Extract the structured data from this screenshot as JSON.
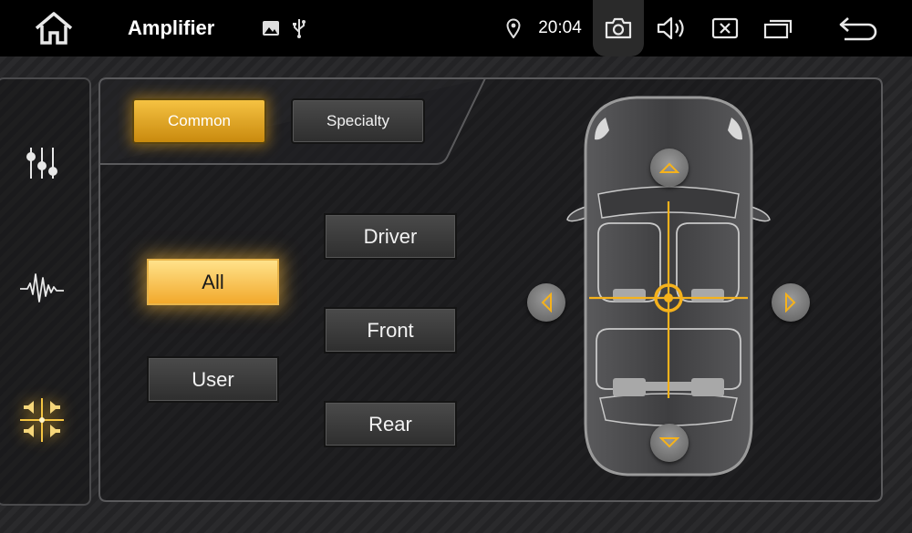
{
  "topbar": {
    "title": "Amplifier",
    "time": "20:04",
    "icons": [
      "home-icon",
      "image-icon",
      "usb-icon",
      "location-icon",
      "camera-icon",
      "volume-icon",
      "close-window-icon",
      "multi-window-icon",
      "back-icon"
    ]
  },
  "sidebar": {
    "items": [
      {
        "icon": "equalizer-sliders-icon"
      },
      {
        "icon": "waveform-icon"
      },
      {
        "icon": "speaker-balance-icon",
        "active": true
      }
    ]
  },
  "mode_tabs": {
    "common_label": "Common",
    "specialty_label": "Specialty",
    "selected": "Common"
  },
  "listen_position": {
    "all_label": "All",
    "user_label": "User",
    "driver_label": "Driver",
    "front_label": "Front",
    "rear_label": "Rear",
    "selected": "All"
  },
  "colors": {
    "accent": "#f5b21c",
    "active_button": "#f7c24a",
    "background": "#202124"
  }
}
